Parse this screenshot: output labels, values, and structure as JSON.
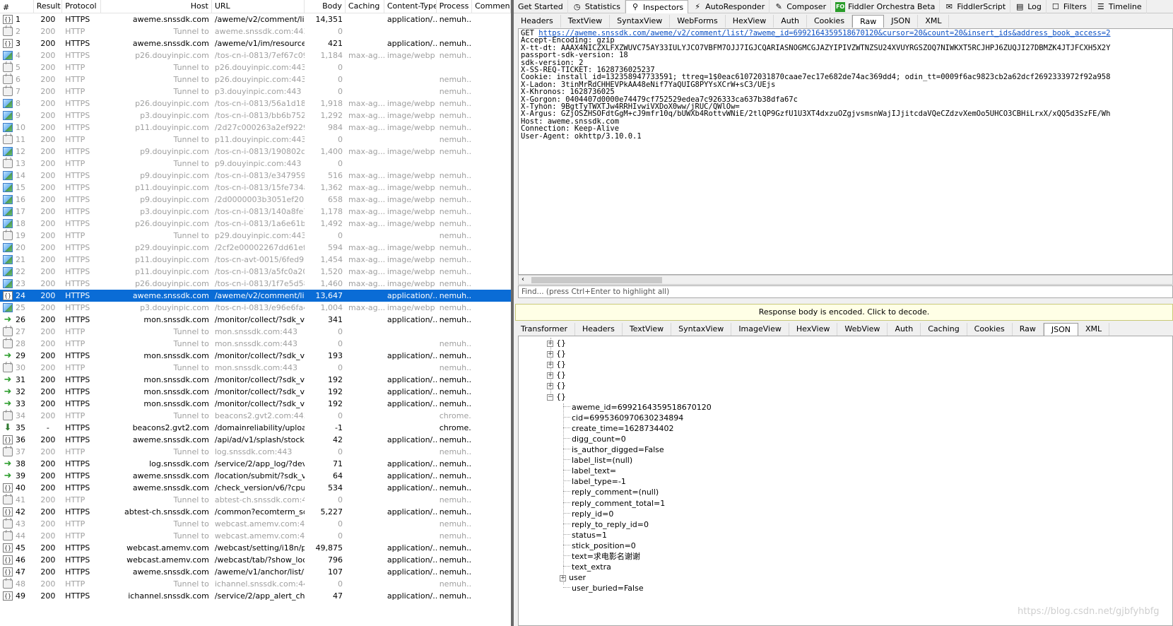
{
  "sessions": {
    "columns": {
      "num": "#",
      "result": "Result",
      "protocol": "Protocol",
      "host": "Host",
      "url": "URL",
      "body": "Body",
      "caching": "Caching",
      "content_type": "Content-Type",
      "process": "Process",
      "comments": "Comment"
    },
    "rows": [
      {
        "num": "1",
        "icon": "json",
        "result": "200",
        "protocol": "HTTPS",
        "host": "aweme.snssdk.com",
        "url": "/aweme/v2/comment/list/...",
        "body": "14,351",
        "caching": "",
        "ctype": "application/...",
        "process": "nemuh...",
        "kind": "normal"
      },
      {
        "num": "2",
        "icon": "lock",
        "result": "200",
        "protocol": "HTTP",
        "host": "Tunnel to",
        "url": "aweme.snssdk.com:443",
        "body": "0",
        "caching": "",
        "ctype": "",
        "process": "",
        "kind": "tunnel"
      },
      {
        "num": "3",
        "icon": "json",
        "result": "200",
        "protocol": "HTTPS",
        "host": "aweme.snssdk.com",
        "url": "/aweme/v1/im/resources/...",
        "body": "421",
        "caching": "",
        "ctype": "application/...",
        "process": "nemuh...",
        "kind": "normal"
      },
      {
        "num": "4",
        "icon": "img",
        "result": "200",
        "protocol": "HTTPS",
        "host": "p26.douyinpic.com",
        "url": "/tos-cn-i-0813/7ef67c094...",
        "body": "1,184",
        "caching": "max-ag...",
        "ctype": "image/webp",
        "process": "nemuh...",
        "kind": "tunnel"
      },
      {
        "num": "5",
        "icon": "lock",
        "result": "200",
        "protocol": "HTTP",
        "host": "Tunnel to",
        "url": "p26.douyinpic.com:443",
        "body": "0",
        "caching": "",
        "ctype": "",
        "process": "",
        "kind": "tunnel"
      },
      {
        "num": "6",
        "icon": "lock",
        "result": "200",
        "protocol": "HTTP",
        "host": "Tunnel to",
        "url": "p26.douyinpic.com:443",
        "body": "0",
        "caching": "",
        "ctype": "",
        "process": "nemuh...",
        "kind": "tunnel"
      },
      {
        "num": "7",
        "icon": "lock",
        "result": "200",
        "protocol": "HTTP",
        "host": "Tunnel to",
        "url": "p3.douyinpic.com:443",
        "body": "0",
        "caching": "",
        "ctype": "",
        "process": "nemuh...",
        "kind": "tunnel"
      },
      {
        "num": "8",
        "icon": "img",
        "result": "200",
        "protocol": "HTTPS",
        "host": "p26.douyinpic.com",
        "url": "/tos-cn-i-0813/56a1d1839...",
        "body": "1,918",
        "caching": "max-ag...",
        "ctype": "image/webp",
        "process": "nemuh...",
        "kind": "tunnel"
      },
      {
        "num": "9",
        "icon": "img",
        "result": "200",
        "protocol": "HTTPS",
        "host": "p3.douyinpic.com",
        "url": "/tos-cn-i-0813/bb6b75209...",
        "body": "1,292",
        "caching": "max-ag...",
        "ctype": "image/webp",
        "process": "nemuh...",
        "kind": "tunnel"
      },
      {
        "num": "10",
        "icon": "img",
        "result": "200",
        "protocol": "HTTPS",
        "host": "p11.douyinpic.com",
        "url": "/2d27c000263a2ef9229e...",
        "body": "984",
        "caching": "max-ag...",
        "ctype": "image/webp",
        "process": "nemuh...",
        "kind": "tunnel"
      },
      {
        "num": "11",
        "icon": "lock",
        "result": "200",
        "protocol": "HTTP",
        "host": "Tunnel to",
        "url": "p11.douyinpic.com:443",
        "body": "0",
        "caching": "",
        "ctype": "",
        "process": "nemuh...",
        "kind": "tunnel"
      },
      {
        "num": "12",
        "icon": "img",
        "result": "200",
        "protocol": "HTTPS",
        "host": "p9.douyinpic.com",
        "url": "/tos-cn-i-0813/190802cbb...",
        "body": "1,400",
        "caching": "max-ag...",
        "ctype": "image/webp",
        "process": "nemuh...",
        "kind": "tunnel"
      },
      {
        "num": "13",
        "icon": "lock",
        "result": "200",
        "protocol": "HTTP",
        "host": "Tunnel to",
        "url": "p9.douyinpic.com:443",
        "body": "0",
        "caching": "",
        "ctype": "",
        "process": "",
        "kind": "tunnel"
      },
      {
        "num": "14",
        "icon": "img",
        "result": "200",
        "protocol": "HTTPS",
        "host": "p9.douyinpic.com",
        "url": "/tos-cn-i-0813/e34795993...",
        "body": "516",
        "caching": "max-ag...",
        "ctype": "image/webp",
        "process": "nemuh...",
        "kind": "tunnel"
      },
      {
        "num": "15",
        "icon": "img",
        "result": "200",
        "protocol": "HTTPS",
        "host": "p11.douyinpic.com",
        "url": "/tos-cn-i-0813/15fe734aa...",
        "body": "1,362",
        "caching": "max-ag...",
        "ctype": "image/webp",
        "process": "nemuh...",
        "kind": "tunnel"
      },
      {
        "num": "16",
        "icon": "img",
        "result": "200",
        "protocol": "HTTPS",
        "host": "p9.douyinpic.com",
        "url": "/2d0000003b3051ef2030...",
        "body": "658",
        "caching": "max-ag...",
        "ctype": "image/webp",
        "process": "nemuh...",
        "kind": "tunnel"
      },
      {
        "num": "17",
        "icon": "img",
        "result": "200",
        "protocol": "HTTPS",
        "host": "p3.douyinpic.com",
        "url": "/tos-cn-i-0813/140a8fe7f...",
        "body": "1,178",
        "caching": "max-ag...",
        "ctype": "image/webp",
        "process": "nemuh...",
        "kind": "tunnel"
      },
      {
        "num": "18",
        "icon": "img",
        "result": "200",
        "protocol": "HTTPS",
        "host": "p26.douyinpic.com",
        "url": "/tos-cn-i-0813/1a6e61bbc...",
        "body": "1,492",
        "caching": "max-ag...",
        "ctype": "image/webp",
        "process": "nemuh...",
        "kind": "tunnel"
      },
      {
        "num": "19",
        "icon": "lock",
        "result": "200",
        "protocol": "HTTP",
        "host": "Tunnel to",
        "url": "p29.douyinpic.com:443",
        "body": "0",
        "caching": "",
        "ctype": "",
        "process": "nemuh...",
        "kind": "tunnel"
      },
      {
        "num": "20",
        "icon": "img",
        "result": "200",
        "protocol": "HTTPS",
        "host": "p29.douyinpic.com",
        "url": "/2cf2e00002267dd61ef80...",
        "body": "594",
        "caching": "max-ag...",
        "ctype": "image/webp",
        "process": "nemuh...",
        "kind": "tunnel"
      },
      {
        "num": "21",
        "icon": "img",
        "result": "200",
        "protocol": "HTTPS",
        "host": "p11.douyinpic.com",
        "url": "/tos-cn-avt-0015/6fed973...",
        "body": "1,454",
        "caching": "max-ag...",
        "ctype": "image/webp",
        "process": "nemuh...",
        "kind": "tunnel"
      },
      {
        "num": "22",
        "icon": "img",
        "result": "200",
        "protocol": "HTTPS",
        "host": "p11.douyinpic.com",
        "url": "/tos-cn-i-0813/a5fc0a207...",
        "body": "1,520",
        "caching": "max-ag...",
        "ctype": "image/webp",
        "process": "nemuh...",
        "kind": "tunnel"
      },
      {
        "num": "23",
        "icon": "img",
        "result": "200",
        "protocol": "HTTPS",
        "host": "p26.douyinpic.com",
        "url": "/tos-cn-i-0813/1f7e5d58e...",
        "body": "1,460",
        "caching": "max-ag...",
        "ctype": "image/webp",
        "process": "nemuh...",
        "kind": "tunnel"
      },
      {
        "num": "24",
        "icon": "json",
        "result": "200",
        "protocol": "HTTPS",
        "host": "aweme.snssdk.com",
        "url": "/aweme/v2/comment/list/...",
        "body": "13,647",
        "caching": "",
        "ctype": "application/...",
        "process": "nemuh...",
        "kind": "selected"
      },
      {
        "num": "25",
        "icon": "img",
        "result": "200",
        "protocol": "HTTPS",
        "host": "p3.douyinpic.com",
        "url": "/tos-cn-i-0813/e96e6fa42...",
        "body": "1,004",
        "caching": "max-ag...",
        "ctype": "image/webp",
        "process": "nemuh...",
        "kind": "tunnel"
      },
      {
        "num": "26",
        "icon": "arrow",
        "result": "200",
        "protocol": "HTTPS",
        "host": "mon.snssdk.com",
        "url": "/monitor/collect/?sdk_vers...",
        "body": "341",
        "caching": "",
        "ctype": "application/...",
        "process": "nemuh...",
        "kind": "normal"
      },
      {
        "num": "27",
        "icon": "lock",
        "result": "200",
        "protocol": "HTTP",
        "host": "Tunnel to",
        "url": "mon.snssdk.com:443",
        "body": "0",
        "caching": "",
        "ctype": "",
        "process": "",
        "kind": "tunnel"
      },
      {
        "num": "28",
        "icon": "lock",
        "result": "200",
        "protocol": "HTTP",
        "host": "Tunnel to",
        "url": "mon.snssdk.com:443",
        "body": "0",
        "caching": "",
        "ctype": "",
        "process": "nemuh...",
        "kind": "tunnel"
      },
      {
        "num": "29",
        "icon": "arrow",
        "result": "200",
        "protocol": "HTTPS",
        "host": "mon.snssdk.com",
        "url": "/monitor/collect/?sdk_vers...",
        "body": "193",
        "caching": "",
        "ctype": "application/...",
        "process": "nemuh...",
        "kind": "normal"
      },
      {
        "num": "30",
        "icon": "lock",
        "result": "200",
        "protocol": "HTTP",
        "host": "Tunnel to",
        "url": "mon.snssdk.com:443",
        "body": "0",
        "caching": "",
        "ctype": "",
        "process": "nemuh...",
        "kind": "tunnel"
      },
      {
        "num": "31",
        "icon": "arrow",
        "result": "200",
        "protocol": "HTTPS",
        "host": "mon.snssdk.com",
        "url": "/monitor/collect/?sdk_vers...",
        "body": "192",
        "caching": "",
        "ctype": "application/...",
        "process": "nemuh...",
        "kind": "normal"
      },
      {
        "num": "32",
        "icon": "arrow",
        "result": "200",
        "protocol": "HTTPS",
        "host": "mon.snssdk.com",
        "url": "/monitor/collect/?sdk_vers...",
        "body": "192",
        "caching": "",
        "ctype": "application/...",
        "process": "nemuh...",
        "kind": "normal"
      },
      {
        "num": "33",
        "icon": "arrow",
        "result": "200",
        "protocol": "HTTPS",
        "host": "mon.snssdk.com",
        "url": "/monitor/collect/?sdk_vers...",
        "body": "192",
        "caching": "",
        "ctype": "application/...",
        "process": "nemuh...",
        "kind": "normal"
      },
      {
        "num": "34",
        "icon": "lock",
        "result": "200",
        "protocol": "HTTP",
        "host": "Tunnel to",
        "url": "beacons2.gvt2.com:443",
        "body": "0",
        "caching": "",
        "ctype": "",
        "process": "chrome...",
        "kind": "tunnel"
      },
      {
        "num": "35",
        "icon": "down",
        "result": "-",
        "protocol": "HTTPS",
        "host": "beacons2.gvt2.com",
        "url": "/domainreliability/upload",
        "body": "-1",
        "caching": "",
        "ctype": "",
        "process": "chrome...",
        "kind": "normal"
      },
      {
        "num": "36",
        "icon": "json",
        "result": "200",
        "protocol": "HTTPS",
        "host": "aweme.snssdk.com",
        "url": "/api/ad/v1/splash/stock/?...",
        "body": "42",
        "caching": "",
        "ctype": "application/...",
        "process": "nemuh...",
        "kind": "normal"
      },
      {
        "num": "37",
        "icon": "lock",
        "result": "200",
        "protocol": "HTTP",
        "host": "Tunnel to",
        "url": "log.snssdk.com:443",
        "body": "0",
        "caching": "",
        "ctype": "",
        "process": "nemuh...",
        "kind": "tunnel"
      },
      {
        "num": "38",
        "icon": "arrow",
        "result": "200",
        "protocol": "HTTPS",
        "host": "log.snssdk.com",
        "url": "/service/2/app_log/?devic...",
        "body": "71",
        "caching": "",
        "ctype": "application/...",
        "process": "nemuh...",
        "kind": "normal"
      },
      {
        "num": "39",
        "icon": "arrow",
        "result": "200",
        "protocol": "HTTPS",
        "host": "aweme.snssdk.com",
        "url": "/location/submit/?sdk_ver...",
        "body": "64",
        "caching": "",
        "ctype": "application/...",
        "process": "nemuh...",
        "kind": "normal"
      },
      {
        "num": "40",
        "icon": "json",
        "result": "200",
        "protocol": "HTTPS",
        "host": "aweme.snssdk.com",
        "url": "/check_version/v6/?cpu_a...",
        "body": "534",
        "caching": "",
        "ctype": "application/...",
        "process": "nemuh...",
        "kind": "normal"
      },
      {
        "num": "41",
        "icon": "lock",
        "result": "200",
        "protocol": "HTTP",
        "host": "Tunnel to",
        "url": "abtest-ch.snssdk.com:443",
        "body": "0",
        "caching": "",
        "ctype": "",
        "process": "nemuh...",
        "kind": "tunnel"
      },
      {
        "num": "42",
        "icon": "json",
        "result": "200",
        "protocol": "HTTPS",
        "host": "abtest-ch.snssdk.com",
        "url": "/common?ecomterm_sdk_...",
        "body": "5,227",
        "caching": "",
        "ctype": "application/...",
        "process": "nemuh...",
        "kind": "normal"
      },
      {
        "num": "43",
        "icon": "lock",
        "result": "200",
        "protocol": "HTTP",
        "host": "Tunnel to",
        "url": "webcast.amemv.com:443",
        "body": "0",
        "caching": "",
        "ctype": "",
        "process": "nemuh...",
        "kind": "tunnel"
      },
      {
        "num": "44",
        "icon": "lock",
        "result": "200",
        "protocol": "HTTP",
        "host": "Tunnel to",
        "url": "webcast.amemv.com:443",
        "body": "0",
        "caching": "",
        "ctype": "",
        "process": "nemuh...",
        "kind": "tunnel"
      },
      {
        "num": "45",
        "icon": "json",
        "result": "200",
        "protocol": "HTTPS",
        "host": "webcast.amemv.com",
        "url": "/webcast/setting/i18n/pac...",
        "body": "49,875",
        "caching": "",
        "ctype": "application/...",
        "process": "nemuh...",
        "kind": "normal"
      },
      {
        "num": "46",
        "icon": "json",
        "result": "200",
        "protocol": "HTTPS",
        "host": "webcast.amemv.com",
        "url": "/webcast/tab/?show_loca...",
        "body": "796",
        "caching": "",
        "ctype": "application/...",
        "process": "nemuh...",
        "kind": "normal"
      },
      {
        "num": "47",
        "icon": "json",
        "result": "200",
        "protocol": "HTTPS",
        "host": "aweme.snssdk.com",
        "url": "/aweme/v1/anchor/list/?o...",
        "body": "107",
        "caching": "",
        "ctype": "application/...",
        "process": "nemuh...",
        "kind": "normal"
      },
      {
        "num": "48",
        "icon": "lock",
        "result": "200",
        "protocol": "HTTP",
        "host": "Tunnel to",
        "url": "ichannel.snssdk.com:443",
        "body": "0",
        "caching": "",
        "ctype": "",
        "process": "nemuh...",
        "kind": "tunnel"
      },
      {
        "num": "49",
        "icon": "json",
        "result": "200",
        "protocol": "HTTPS",
        "host": "ichannel.snssdk.com",
        "url": "/service/2/app_alert_chec...",
        "body": "47",
        "caching": "",
        "ctype": "application/...",
        "process": "nemuh...",
        "kind": "normal"
      }
    ]
  },
  "top_tabs": [
    {
      "label": "Get Started",
      "icon": "",
      "name": "tab-get-started"
    },
    {
      "label": "Statistics",
      "icon": "◷",
      "name": "tab-statistics"
    },
    {
      "label": "Inspectors",
      "icon": "⚲",
      "name": "tab-inspectors",
      "active": true
    },
    {
      "label": "AutoResponder",
      "icon": "⚡",
      "name": "tab-autoresponder"
    },
    {
      "label": "Composer",
      "icon": "✎",
      "name": "tab-composer"
    },
    {
      "label": "Fiddler Orchestra Beta",
      "icon": "FO",
      "name": "tab-fiddler-orchestra"
    },
    {
      "label": "FiddlerScript",
      "icon": "✉",
      "name": "tab-fiddlerscript"
    },
    {
      "label": "Log",
      "icon": "▤",
      "name": "tab-log"
    },
    {
      "label": "Filters",
      "icon": "☐",
      "name": "tab-filters"
    },
    {
      "label": "Timeline",
      "icon": "☰",
      "name": "tab-timeline"
    }
  ],
  "request_tabs": [
    "Headers",
    "TextView",
    "SyntaxView",
    "WebForms",
    "HexView",
    "Auth",
    "Cookies",
    "Raw",
    "JSON",
    "XML"
  ],
  "request_active": "Raw",
  "raw_request": {
    "method": "GET ",
    "url": "https://aweme.snssdk.com/aweme/v2/comment/list/?aweme_id=6992164359518670120&cursor=20&count=20&insert_ids&address_book_access=2",
    "lines": [
      "Accept-Encoding: gzip",
      "X-tt-dt: AAAX4NICZXLFXZWUVC75AY33IULYJCO7VBFM7OJJ7IGJCQARIASNOGMCGJAZYIPIVZWTNZSU24XVUYRGSZOQ7NIWKXT5RCJHPJ6ZUQJI27DBMZK4JTJFCXH5X2Y",
      "passport-sdk-version: 18",
      "sdk-version: 2",
      "X-SS-REQ-TICKET: 1628736025237",
      "Cookie: install_id=132358947733591; ttreq=1$0eac61072031870caae7ec17e682de74ac369dd4; odin_tt=0009f6ac9823cb2a62dcf2692333972f92a958",
      "X-Ladon: 3tinMrRdCHHEVPkAA48eNif7YaQUIG8PYYsXCrW+sC3/UEjs",
      "X-Khronos: 1628736025",
      "X-Gorgon: 0404407d0000e74479cf752529edea7c926333ca637b38dfa67c",
      "X-Tyhon: 9BgtTyTWXTJw4RRHIvwiVXDoX0ww/jRUC/QWlOw=",
      "X-Argus: GZjOSZHSOFdtGgM+cJ9mfr10q/bUWXb4RottvWNiE/2tlQP9GzfU1U3XT4dxzuOZgjvsmsnWajIJjitcdaVQeCZdzvXemOo5UHCO3CBHiLrxX/xQQ5d3SzFE/Wh",
      "Host: aweme.snssdk.com",
      "Connection: Keep-Alive",
      "User-Agent: okhttp/3.10.0.1"
    ]
  },
  "find_placeholder": "Find... (press Ctrl+Enter to highlight all)",
  "encoded_notice": "Response body is encoded. Click to decode.",
  "response_tabs": [
    "Transformer",
    "Headers",
    "TextView",
    "SyntaxView",
    "ImageView",
    "HexView",
    "WebView",
    "Auth",
    "Caching",
    "Cookies",
    "Raw",
    "JSON",
    "XML"
  ],
  "response_active": "JSON",
  "json_tree": {
    "collapsed_nodes": [
      "{}",
      "{}",
      "{}",
      "{}",
      "{}"
    ],
    "expanded_node": "{}",
    "fields": [
      "aweme_id=6992164359518670120",
      "cid=6995360970630234894",
      "create_time=1628734402",
      "digg_count=0",
      "is_author_digged=False",
      "label_list=(null)",
      "label_text=",
      "label_type=-1",
      "reply_comment=(null)",
      "reply_comment_total=1",
      "reply_id=0",
      "reply_to_reply_id=0",
      "status=1",
      "stick_position=0",
      "text=求电影名谢谢",
      "text_extra"
    ],
    "user_node": "user",
    "last_field": "user_buried=False"
  },
  "watermark": "https://blog.csdn.net/gjbfyhbfg"
}
